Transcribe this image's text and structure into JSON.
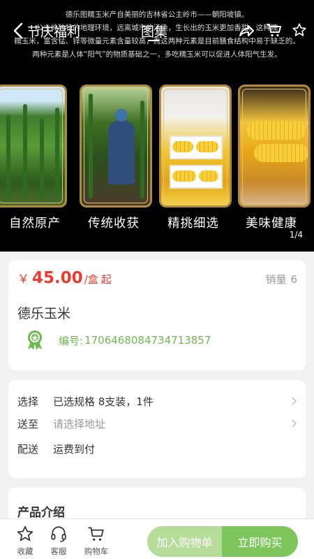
{
  "header": {
    "tabs": [
      {
        "label": "节庆福利"
      },
      {
        "label": "图集"
      }
    ]
  },
  "banner": {
    "text_lines": [
      "德乐图糯玉米产自美丽的吉林省公主岭市——朝阳坡镇。",
      "公主岭独特的地理环境，远离城市的污染，生长出的玉米更加香甜。这种糯",
      "糯玉米，富含锰、锌等微量元素含量较高，而这两种元素是目前膳食结构中易于缺乏的。",
      "两种元素是人体“阳气”的物质基础之一，多吃糯玉米可以促进人体阳气生发。"
    ],
    "captions": [
      "自然原产",
      "传统收获",
      "精挑细选",
      "美味健康"
    ],
    "pager": "1/4"
  },
  "product": {
    "currency": "￥",
    "price": "45.00",
    "unit": "/盒",
    "qualifier": "起",
    "sales_label": "销量",
    "sales_value": "6",
    "title": "德乐玉米",
    "code_label": "编号:",
    "code_value": "1706468084734713857"
  },
  "spec": {
    "rows": [
      {
        "label": "选择",
        "value": "已选规格 8支装，1件"
      },
      {
        "label": "送至",
        "value": "请选择地址"
      },
      {
        "label": "配送",
        "value": "运费到付"
      }
    ]
  },
  "intro": {
    "title": "产品介绍"
  },
  "bottom_bar": {
    "favorite_label": "收藏",
    "service_label": "客服",
    "cart_label": "购物车",
    "add_to_cart_label": "加入购物单",
    "buy_now_label": "立即购买"
  },
  "colors": {
    "price_red": "#ef3b2d",
    "accent_green": "#7ec65c",
    "light_green": "#b6dc9a",
    "code_green": "#6cbb4f"
  }
}
